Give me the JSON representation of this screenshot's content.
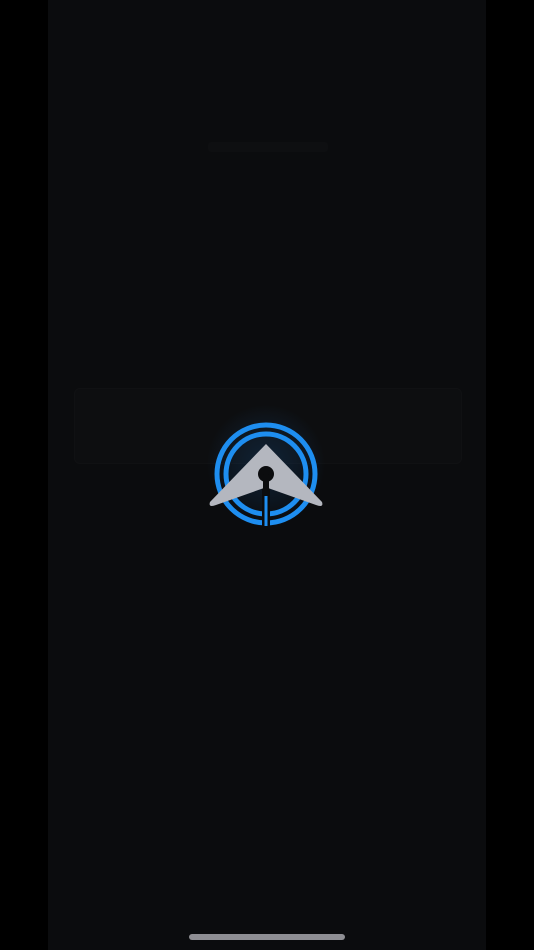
{
  "app": {
    "screen": "splash"
  },
  "logo": {
    "icon": "keyhole-arrow-logo-icon",
    "ring_color": "#1e8ef0",
    "arrow_color": "#b4b7bf",
    "background": "#0b0c0e"
  },
  "home_indicator": {
    "color": "#8e8e93"
  }
}
